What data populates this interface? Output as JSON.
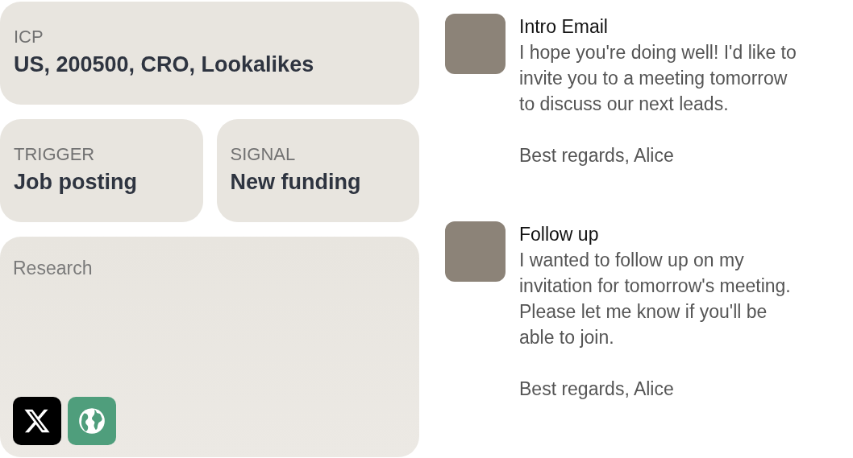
{
  "icp": {
    "label": "ICP",
    "value": "US, 200500, CRO, Lookalikes"
  },
  "criteria": [
    {
      "label": "TRIGGER",
      "value": "Job posting"
    },
    {
      "label": "SIGNAL",
      "value": "New funding"
    }
  ],
  "research": {
    "label": "Research",
    "sources": [
      {
        "kind": "x"
      },
      {
        "kind": "web"
      }
    ]
  },
  "messages": [
    {
      "title": "Intro Email",
      "paragraphs": [
        "I hope you're doing well! I'd like to invite you to a meeting tomorrow to discuss our next leads.",
        "Best regards, Alice"
      ]
    },
    {
      "title": "Follow up",
      "paragraphs": [
        "I wanted to follow up on my invitation for tomorrow's meeting. Please let me know if you'll be able to join.",
        "Best regards, Alice"
      ]
    }
  ]
}
